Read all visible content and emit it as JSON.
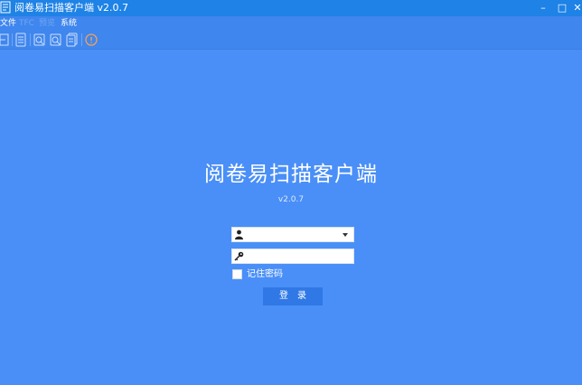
{
  "window": {
    "title": "阅卷易扫描客户端 v2.0.7",
    "minimize_glyph": "–",
    "maximize_glyph": "□",
    "close_glyph": "✕"
  },
  "menu": {
    "items": [
      {
        "label": "文件",
        "enabled": true
      },
      {
        "label": "TFC",
        "enabled": false
      },
      {
        "label": "预览",
        "enabled": false
      },
      {
        "label": "系统",
        "enabled": true
      }
    ]
  },
  "toolbar": {
    "icons": [
      "exit-icon",
      "document-icon",
      "scan-icon",
      "scan-settings-icon",
      "copy-pages-icon",
      "about-icon"
    ]
  },
  "login": {
    "app_title": "阅卷易扫描客户端",
    "version": "v2.0.7",
    "username_value": "",
    "password_value": "",
    "remember_label": "记住密码",
    "remember_checked": false,
    "login_label": "登录"
  },
  "colors": {
    "background": "#4a8ff7",
    "titlebar": "#1e82e6",
    "button": "#2f78e6"
  }
}
